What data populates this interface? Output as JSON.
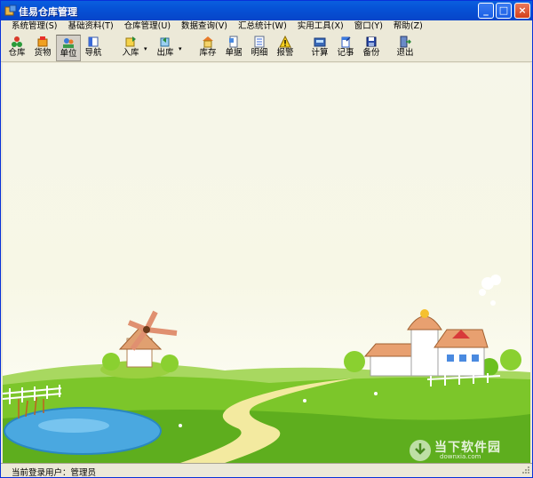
{
  "window": {
    "title": "佳易仓库管理"
  },
  "title_controls": {
    "minimize": "_",
    "maximize": "□",
    "close": "×"
  },
  "menu": [
    "系统管理(S)",
    "基础资料(T)",
    "仓库管理(U)",
    "数据查询(V)",
    "汇总统计(W)",
    "实用工具(X)",
    "窗口(Y)",
    "帮助(Z)"
  ],
  "toolbar": {
    "warehouse": "仓库",
    "goods": "货物",
    "unit": "单位",
    "nav": "导航",
    "stock_in": "入库",
    "stock_out": "出库",
    "inventory": "库存",
    "document": "单据",
    "detail": "明细",
    "alarm": "报警",
    "calculator": "计算",
    "notes": "记事",
    "backup": "备份",
    "exit": "退出"
  },
  "status": {
    "user_text": "当前登录用户：管理员"
  },
  "watermark": {
    "cn": "当下软件园",
    "en": "downxia.com"
  },
  "colors": {
    "titlebar": "#0652d6",
    "grass": "#6fbf1f",
    "pond": "#4aa8e0",
    "path": "#f3eaa0"
  }
}
